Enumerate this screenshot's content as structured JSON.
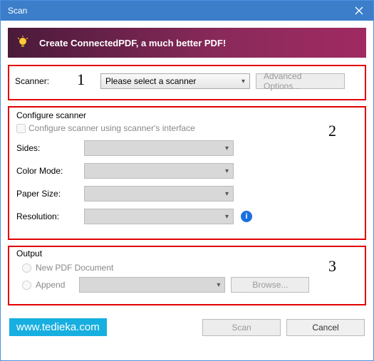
{
  "window": {
    "title": "Scan"
  },
  "banner": {
    "text": "Create ConnectedPDF, a much better PDF!"
  },
  "annotations": {
    "one": "1",
    "two": "2",
    "three": "3"
  },
  "scanner": {
    "label": "Scanner:",
    "placeholder": "Please select a scanner",
    "advanced": "Advanced Options..."
  },
  "configure": {
    "legend": "Configure scanner",
    "checkbox_label": "Configure scanner using scanner's interface",
    "sides": "Sides:",
    "color_mode": "Color Mode:",
    "paper_size": "Paper Size:",
    "resolution": "Resolution:"
  },
  "output": {
    "legend": "Output",
    "new_pdf": "New PDF Document",
    "append": "Append",
    "browse": "Browse..."
  },
  "footer": {
    "watermark": "www.tedieka.com",
    "scan": "Scan",
    "cancel": "Cancel"
  }
}
